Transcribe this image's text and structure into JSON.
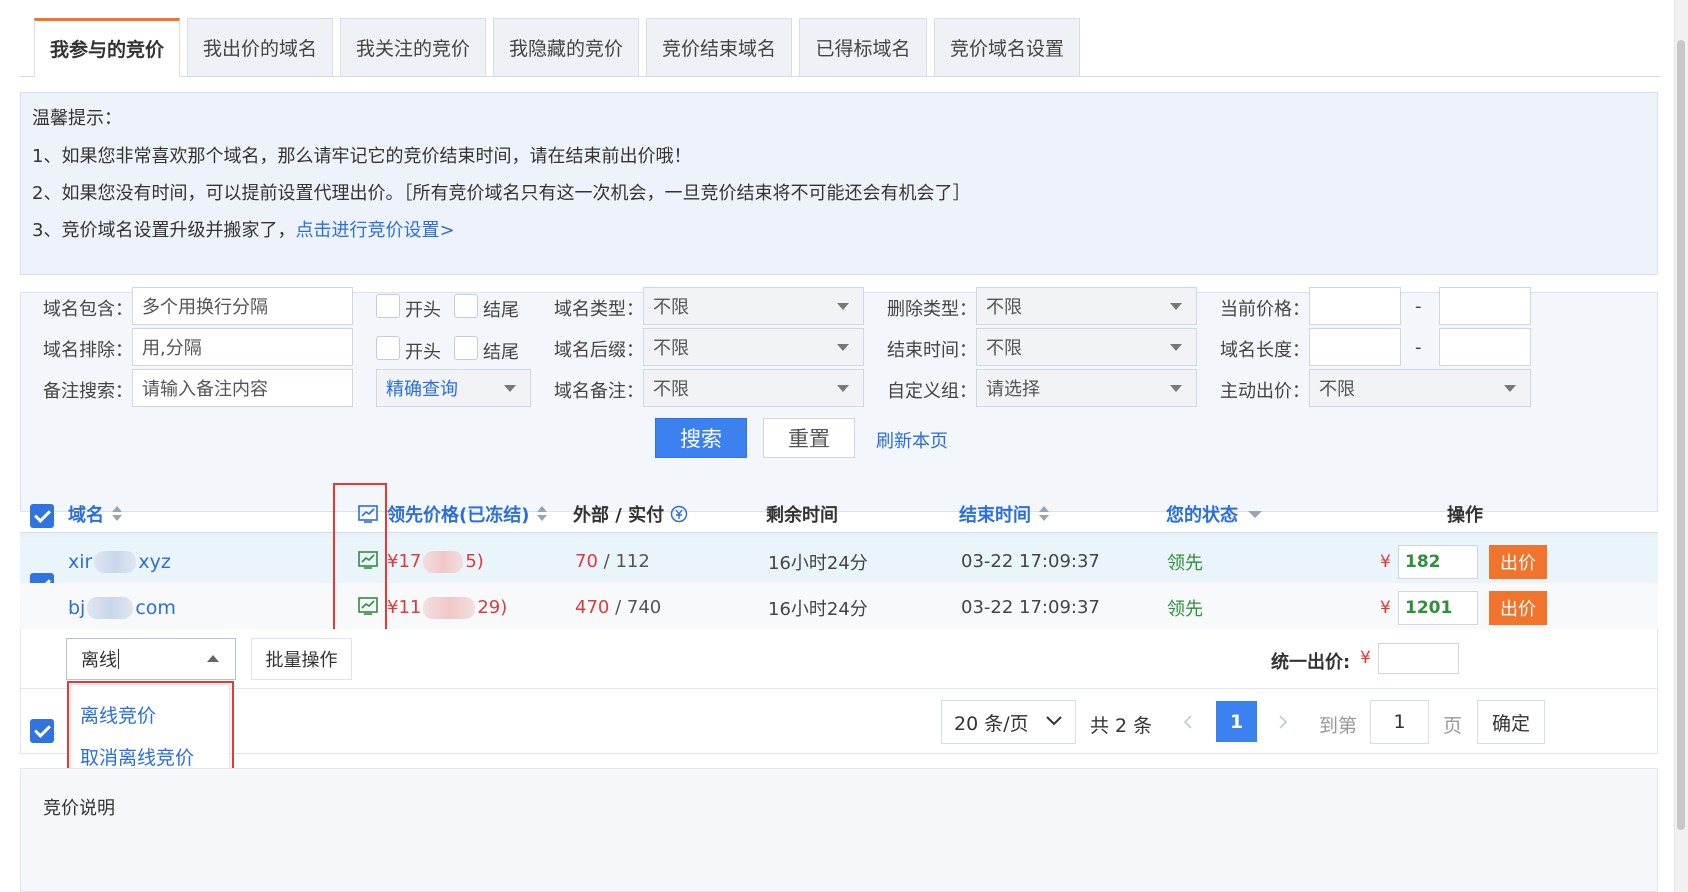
{
  "tabs": [
    {
      "label": "我参与的竞价",
      "active": true
    },
    {
      "label": "我出价的域名",
      "active": false
    },
    {
      "label": "我关注的竞价",
      "active": false
    },
    {
      "label": "我隐藏的竞价",
      "active": false
    },
    {
      "label": "竞价结束域名",
      "active": false
    },
    {
      "label": "已得标域名",
      "active": false
    },
    {
      "label": "竞价域名设置",
      "active": false
    }
  ],
  "tips": {
    "title": "温馨提示：",
    "line1": "1、如果您非常喜欢那个域名，那么请牢记它的竞价结束时间，请在结束前出价哦！",
    "line2": "2、如果您没有时间，可以提前设置代理出价。［所有竞价域名只有这一次机会，一旦竞价结束将不可能还会有机会了］",
    "line3_prefix": "3、竞价域名设置升级并搬家了，",
    "line3_link": "点击进行竞价设置>"
  },
  "filter": {
    "domain_contains_label": "域名包含：",
    "domain_contains_placeholder": "多个用换行分隔",
    "domain_exclude_label": "域名排除：",
    "domain_exclude_placeholder": "用,分隔",
    "note_search_label": "备注搜索：",
    "note_search_placeholder": "请输入备注内容",
    "start_label": "开头",
    "end_label": "结尾",
    "match_mode": "精确查询",
    "domain_type_label": "域名类型：",
    "domain_type_value": "不限",
    "domain_suffix_label": "域名后缀：",
    "domain_suffix_value": "不限",
    "domain_note_label": "域名备注：",
    "domain_note_value": "不限",
    "delete_type_label": "删除类型：",
    "delete_type_value": "不限",
    "end_time_label": "结束时间：",
    "end_time_value": "不限",
    "custom_group_label": "自定义组：",
    "custom_group_value": "请选择",
    "current_price_label": "当前价格：",
    "domain_length_label": "域名长度：",
    "range_sep": "-",
    "active_bid_label": "主动出价：",
    "active_bid_value": "不限",
    "search_button": "搜索",
    "reset_button": "重置",
    "refresh_link": "刷新本页"
  },
  "table": {
    "headers": {
      "domain": "域名",
      "leading_price": "领先价格(已冻结)",
      "external_actual": "外部 / 实付",
      "remaining": "剩余时间",
      "end_time": "结束时间",
      "status": "您的状态",
      "action": "操作"
    },
    "rows": [
      {
        "domain_start": "xir",
        "domain_end": "xyz",
        "price_start": "¥17",
        "price_end": "5)",
        "external": "70",
        "sep": "/",
        "actual": "112",
        "remaining": "16小时24分",
        "end_time": "03-22 17:09:37",
        "status": "领先",
        "yen": "¥",
        "bid_value": "182",
        "bid_button": "出价"
      },
      {
        "domain_start": "bj",
        "domain_end": "com",
        "price_start": "¥11",
        "price_end": "29)",
        "external": "470",
        "sep": "/",
        "actual": "740",
        "remaining": "16小时24分",
        "end_time": "03-22 17:09:37",
        "status": "领先",
        "yen": "¥",
        "bid_value": "1201",
        "bid_button": "出价"
      }
    ]
  },
  "batch": {
    "select_value": "离线",
    "batch_button": "批量操作",
    "dropdown_items": [
      "离线竞价",
      "取消离线竞价"
    ],
    "unified_label": "统一出价:",
    "yen": "¥"
  },
  "pagination": {
    "page_size": "20 条/页",
    "total": "共 2 条",
    "current": "1",
    "goto_label": "到第",
    "goto_value": "1",
    "page_unit": "页",
    "confirm": "确定"
  },
  "section_title": "竞价说明",
  "colors": {
    "accent_blue": "#3b82f0",
    "link_blue": "#2a6fdb",
    "orange": "#f0742b",
    "green": "#2f8f3a",
    "red": "#e03a3a",
    "highlight_red": "#e53935"
  }
}
